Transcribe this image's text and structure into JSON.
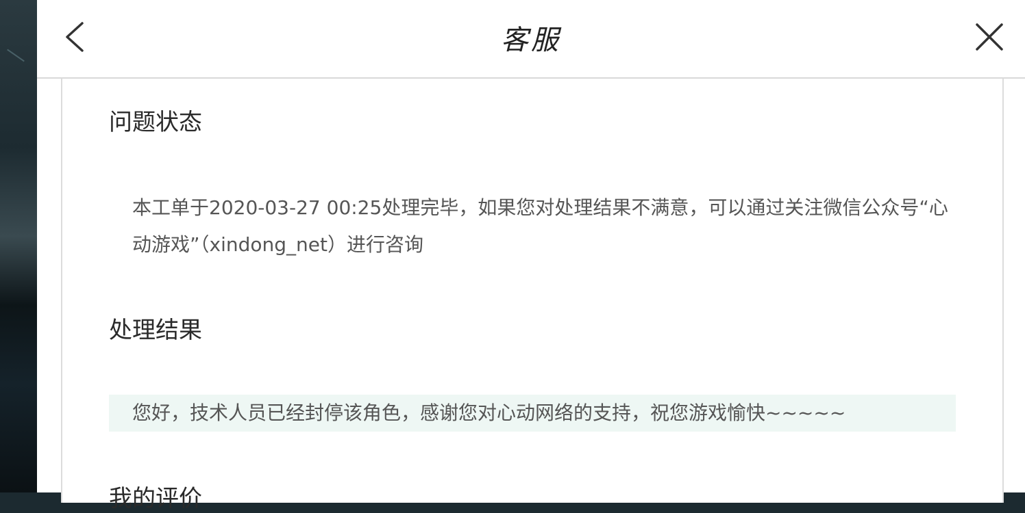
{
  "header": {
    "title": "客服",
    "back_icon": "chevron-left-icon",
    "close_icon": "close-icon"
  },
  "sections": {
    "status": {
      "title": "问题状态",
      "text": "本工单于2020-03-27 00:25处理完毕，如果您对处理结果不满意，可以通过关注微信公众号“心动游戏”（xindong_net）进行咨询"
    },
    "result": {
      "title": "处理结果",
      "text": "您好，技术人员已经封停该角色，感谢您对心动网络的支持，祝您游戏愉快~~~~~"
    },
    "review": {
      "title": "我的评价"
    }
  },
  "colors": {
    "result_background": "#eef7f4",
    "divider": "#d9d9d9"
  }
}
